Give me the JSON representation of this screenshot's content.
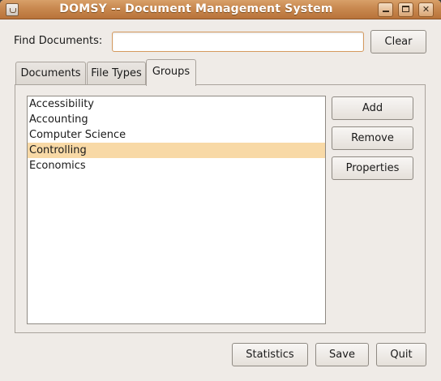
{
  "window": {
    "title": "DOMSY -- Document Management System",
    "icon": "java-cup-icon",
    "controls": [
      "minimize-icon",
      "maximize-icon",
      "close-icon"
    ],
    "close_glyph": "✕"
  },
  "search": {
    "label": "Find Documents:",
    "value": "",
    "placeholder": "",
    "clear_label": "Clear"
  },
  "tabs": [
    {
      "label": "Documents",
      "active": false
    },
    {
      "label": "File Types",
      "active": false
    },
    {
      "label": "Groups",
      "active": true
    }
  ],
  "groups": {
    "items": [
      "Accessibility",
      "Accounting",
      "Computer Science",
      "Controlling",
      "Economics"
    ],
    "selected": "Controlling",
    "actions": {
      "add": "Add",
      "remove": "Remove",
      "properties": "Properties"
    }
  },
  "footer": {
    "statistics_label": "Statistics",
    "save_label": "Save",
    "quit_label": "Quit"
  },
  "colors": {
    "titlebar": "#c8884f",
    "selection": "#f8d9a6",
    "window_bg": "#efebe7"
  }
}
